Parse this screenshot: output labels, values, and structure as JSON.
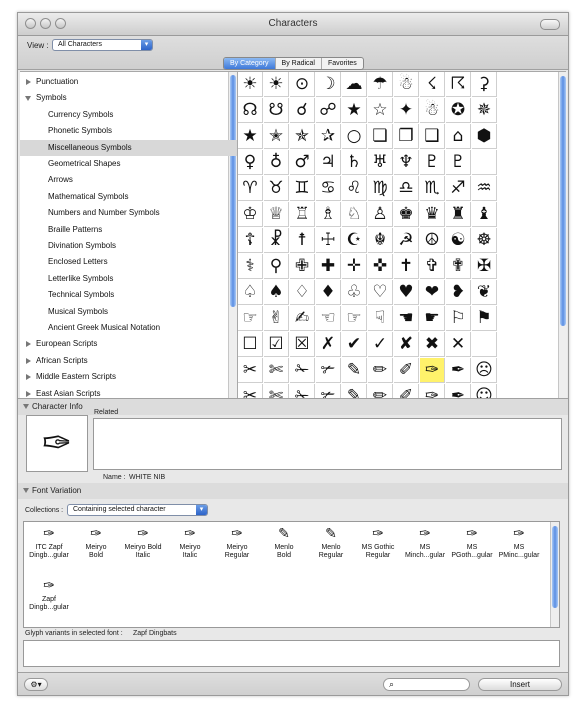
{
  "window": {
    "title": "Characters"
  },
  "toolbar": {
    "view_label": "View :",
    "view_value": "All Characters",
    "tabs": [
      {
        "label": "By Category",
        "active": true
      },
      {
        "label": "By Radical",
        "active": false
      },
      {
        "label": "Favorites",
        "active": false
      }
    ]
  },
  "categories": {
    "items": [
      {
        "label": "Punctuation",
        "level": 0,
        "expanded": false
      },
      {
        "label": "Symbols",
        "level": 0,
        "expanded": true
      },
      {
        "label": "Currency Symbols",
        "level": 1
      },
      {
        "label": "Phonetic Symbols",
        "level": 1
      },
      {
        "label": "Miscellaneous Symbols",
        "level": 1,
        "selected": true
      },
      {
        "label": "Geometrical Shapes",
        "level": 1
      },
      {
        "label": "Arrows",
        "level": 1
      },
      {
        "label": "Mathematical Symbols",
        "level": 1
      },
      {
        "label": "Numbers and Number Symbols",
        "level": 1
      },
      {
        "label": "Braille Patterns",
        "level": 1
      },
      {
        "label": "Divination Symbols",
        "level": 1
      },
      {
        "label": "Enclosed Letters",
        "level": 1
      },
      {
        "label": "Letterlike Symbols",
        "level": 1
      },
      {
        "label": "Technical Symbols",
        "level": 1
      },
      {
        "label": "Musical Symbols",
        "level": 1
      },
      {
        "label": "Ancient Greek Musical Notation",
        "level": 1
      },
      {
        "label": "European Scripts",
        "level": 0,
        "expanded": false
      },
      {
        "label": "African Scripts",
        "level": 0,
        "expanded": false
      },
      {
        "label": "Middle Eastern Scripts",
        "level": 0,
        "expanded": false
      },
      {
        "label": "East Asian Scripts",
        "level": 0,
        "expanded": false
      }
    ]
  },
  "characters": {
    "rows": [
      [
        "☀",
        "☀",
        "⊙",
        "☽",
        "☁",
        "☂",
        "☃",
        "☇",
        "☈",
        "⚳"
      ],
      [
        "☊",
        "☋",
        "☌",
        "☍",
        "★",
        "☆",
        "✦",
        "☃",
        "✪",
        "✵"
      ],
      [
        "★",
        "✭",
        "✯",
        "✰",
        "○",
        "❏",
        "❐",
        "❑",
        "⌂",
        "⬢"
      ],
      [
        "♀",
        "♁",
        "♂",
        "♃",
        "♄",
        "♅",
        "♆",
        "♇",
        "♇",
        ""
      ],
      [
        "♈",
        "♉",
        "♊",
        "♋",
        "♌",
        "♍",
        "♎",
        "♏",
        "♐",
        "♒"
      ],
      [
        "♔",
        "♕",
        "♖",
        "♗",
        "♘",
        "♙",
        "♚",
        "♛",
        "♜",
        "♝"
      ],
      [
        "☦",
        "☧",
        "☨",
        "☩",
        "☪",
        "☬",
        "☭",
        "☮",
        "☯",
        "☸"
      ],
      [
        "⚕",
        "⚲",
        "✙",
        "✚",
        "✛",
        "✜",
        "✝",
        "✞",
        "✟",
        "✠"
      ],
      [
        "♤",
        "♠",
        "♢",
        "♦",
        "♧",
        "♡",
        "♥",
        "❤",
        "❥",
        "❦"
      ],
      [
        "☞",
        "✌",
        "✍",
        "☜",
        "☞",
        "☟",
        "☚",
        "☛",
        "⚐",
        "⚑"
      ],
      [
        "☐",
        "☑",
        "☒",
        "✗",
        "✔",
        "✓",
        "✘",
        "✖",
        "✕",
        ""
      ],
      [
        "✂",
        "✄",
        "✁",
        "✃",
        "✎",
        "✏",
        "✐",
        "✑",
        "✒",
        "☹"
      ],
      [
        "✂",
        "✄",
        "✁",
        "✃",
        "✎",
        "✏",
        "✐",
        "✑",
        "✒",
        "☺"
      ]
    ],
    "selected": {
      "row": 11,
      "col": 7
    }
  },
  "character_info": {
    "header": "Character Info",
    "related_label": "Related",
    "preview_glyph": "✑",
    "name_label": "Name :",
    "name_value": "WHITE NIB"
  },
  "font_variation": {
    "header": "Font Variation",
    "collections_label": "Collections :",
    "collections_value": "Containing selected character",
    "fonts": [
      {
        "glyph": "✑",
        "name_line1": "ITC Zapf",
        "name_line2": "Dingb...gular"
      },
      {
        "glyph": "✑",
        "name_line1": "Meiryo",
        "name_line2": "Bold"
      },
      {
        "glyph": "✑",
        "name_line1": "Meiryo Bold",
        "name_line2": "Italic"
      },
      {
        "glyph": "✑",
        "name_line1": "Meiryo",
        "name_line2": "Italic"
      },
      {
        "glyph": "✑",
        "name_line1": "Meiryo",
        "name_line2": "Regular"
      },
      {
        "glyph": "✎",
        "name_line1": "Menlo",
        "name_line2": "Bold"
      },
      {
        "glyph": "✎",
        "name_line1": "Menlo",
        "name_line2": "Regular"
      },
      {
        "glyph": "✑",
        "name_line1": "MS Gothic",
        "name_line2": "Regular"
      },
      {
        "glyph": "✑",
        "name_line1": "MS",
        "name_line2": "Minch...gular"
      },
      {
        "glyph": "✑",
        "name_line1": "MS",
        "name_line2": "PGoth...gular"
      },
      {
        "glyph": "✑",
        "name_line1": "MS",
        "name_line2": "PMinc...gular"
      },
      {
        "glyph": "✑",
        "name_line1": "Zapf",
        "name_line2": "Dingb...gular"
      }
    ],
    "glyph_variants_label": "Glyph variants in selected font :",
    "glyph_variants_font": "Zapf Dingbats"
  },
  "bottom": {
    "gear_icon": "gear-icon",
    "search_placeholder": "",
    "insert_label": "Insert"
  }
}
